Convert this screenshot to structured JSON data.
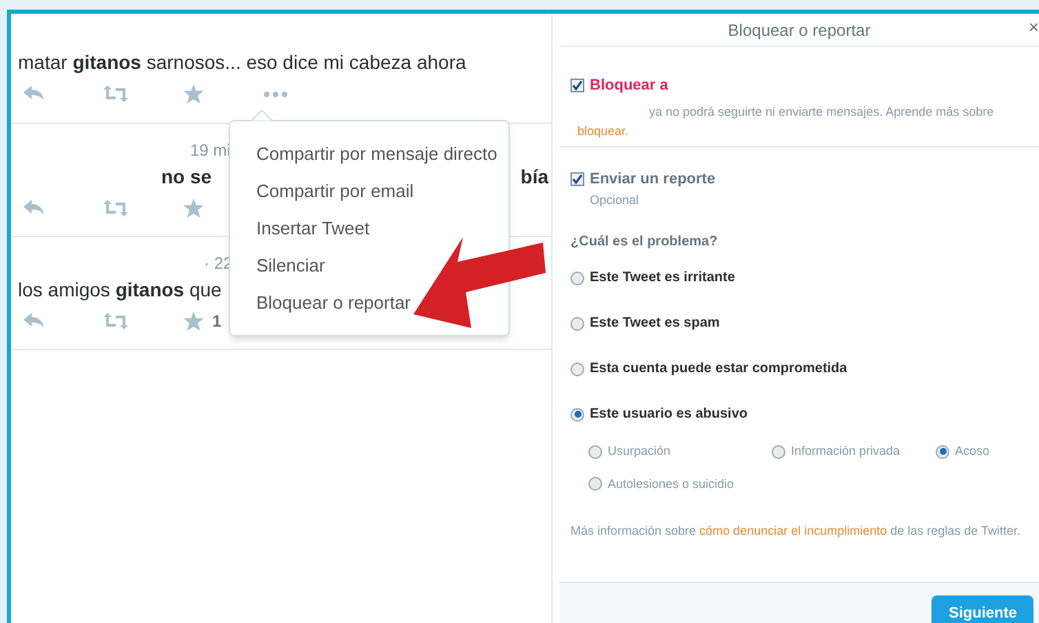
{
  "tweets": [
    {
      "text_parts": [
        "matar **gitanos** sarnosos... eso dice mi cabeza ahora"
      ],
      "actions": [
        {
          "kind": "reply"
        },
        {
          "kind": "retweet"
        },
        {
          "kind": "favorite"
        },
        {
          "kind": "more"
        }
      ]
    },
    {
      "time": "19 mi",
      "text_parts": [
        "no se",
        "bía"
      ],
      "actions": [
        {
          "kind": "reply"
        },
        {
          "kind": "retweet"
        },
        {
          "kind": "favorite"
        }
      ]
    },
    {
      "time": "· 22",
      "text_parts": [
        "los amigos **gitanos** que"
      ],
      "actions": [
        {
          "kind": "reply"
        },
        {
          "kind": "retweet"
        },
        {
          "kind": "favorite",
          "count": "1"
        }
      ]
    }
  ],
  "menu": {
    "items": [
      "Compartir por mensaje directo",
      "Compartir por email",
      "Insertar Tweet",
      "Silenciar",
      "Bloquear o reportar"
    ]
  },
  "dialog": {
    "title": "Bloquear o reportar",
    "close": "×",
    "block": {
      "checked": true,
      "label": "Bloquear a",
      "text": "ya no podrá seguirte ni enviarte mensajes. Aprende más sobre",
      "link": "bloquear."
    },
    "report": {
      "checked": true,
      "label": "Enviar un reporte",
      "sublabel": "Opcional"
    },
    "question": "¿Cuál es el problema?",
    "options": [
      {
        "label": "Este Tweet es irritante",
        "selected": false
      },
      {
        "label": "Este Tweet es spam",
        "selected": false
      },
      {
        "label": "Esta cuenta puede estar comprometida",
        "selected": false
      },
      {
        "label": "Este usuario es abusivo",
        "selected": true
      }
    ],
    "sub_options": [
      {
        "label": "Usurpación",
        "selected": false
      },
      {
        "label": "Información privada",
        "selected": false
      },
      {
        "label": "Acoso",
        "selected": true
      },
      {
        "label": "Autolesiones o suicidio",
        "selected": false
      }
    ],
    "note": {
      "before": "Más información sobre",
      "link": "cómo denunciar el incumplimiento",
      "after": "de las reglas de Twitter."
    },
    "button": "Siguiente"
  }
}
